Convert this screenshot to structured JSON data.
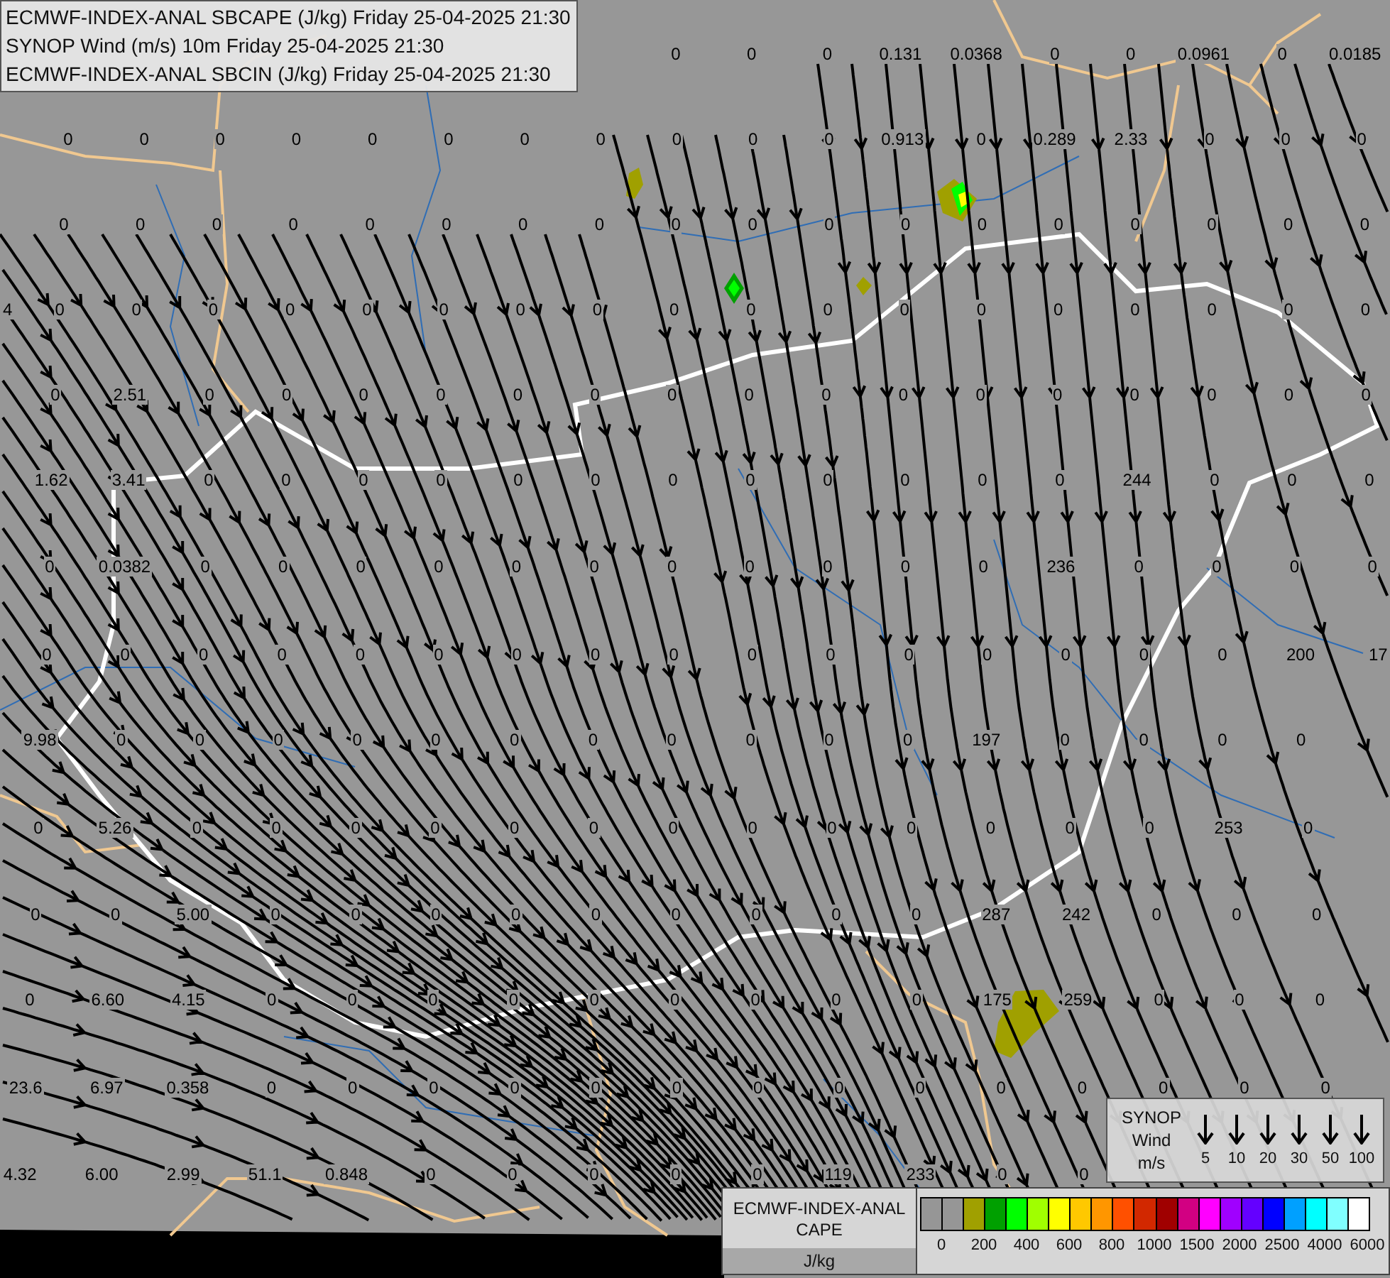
{
  "header": {
    "lines": [
      "ECMWF-INDEX-ANAL SBCAPE (J/kg) Friday 25-04-2025 21:30",
      "SYNOP Wind (m/s) 10m Friday 25-04-2025 21:30",
      "ECMWF-INDEX-ANAL SBCIN (J/kg) Friday 25-04-2025 21:30"
    ]
  },
  "map": {
    "value_rows": [
      [
        "0",
        "0",
        "0",
        "0.131",
        "0.0368",
        "0",
        "0",
        "0.0961",
        "0",
        "0.0185"
      ],
      [
        "0",
        "0",
        "0",
        "0",
        "0",
        "0",
        "0",
        "0",
        "0",
        "0",
        "0",
        "0.913",
        "0",
        "0.289",
        "2.33",
        "0",
        "0",
        "0"
      ],
      [
        "0",
        "0",
        "0",
        "0",
        "0",
        "0",
        "0",
        "0",
        "0",
        "0",
        "0",
        "0",
        "0",
        "0",
        "0",
        "0",
        "0",
        "0"
      ],
      [
        "4",
        "0",
        "0",
        "0",
        "0",
        "0",
        "0",
        "0",
        "0",
        "0",
        "0",
        "0",
        "0",
        "0",
        "0",
        "0",
        "0",
        "0",
        "0"
      ],
      [
        "0",
        "2.51",
        "0",
        "0",
        "0",
        "0",
        "0",
        "0",
        "0",
        "0",
        "0",
        "0",
        "0",
        "0",
        "0",
        "0",
        "0",
        "0"
      ],
      [
        "1.62",
        "3.41",
        "0",
        "0",
        "0",
        "0",
        "0",
        "0",
        "0",
        "0",
        "0",
        "0",
        "0",
        "0",
        "244",
        "0",
        "0",
        "0"
      ],
      [
        "0",
        "0.0382",
        "0",
        "0",
        "0",
        "0",
        "0",
        "0",
        "0",
        "0",
        "0",
        "0",
        "0",
        "236",
        "0",
        "0",
        "0",
        "0"
      ],
      [
        "0",
        "0",
        "0",
        "0",
        "0",
        "0",
        "0",
        "0",
        "0",
        "0",
        "0",
        "0",
        "0",
        "0",
        "0",
        "0",
        "200",
        "17"
      ],
      [
        "9.98",
        "0",
        "0",
        "0",
        "0",
        "0",
        "0",
        "0",
        "0",
        "0",
        "0",
        "0",
        "197",
        "0",
        "0",
        "0",
        "0"
      ],
      [
        "0",
        "5.26",
        "0",
        "0",
        "0",
        "0",
        "0",
        "0",
        "0",
        "0",
        "0",
        "0",
        "0",
        "0",
        "0",
        "253",
        "0"
      ],
      [
        "0",
        "0",
        "5.00",
        "0",
        "0",
        "0",
        "0",
        "0",
        "0",
        "0",
        "0",
        "0",
        "287",
        "242",
        "0",
        "0",
        "0"
      ],
      [
        "0",
        "6.60",
        "4.15",
        "0",
        "0",
        "0",
        "0",
        "0",
        "0",
        "0",
        "0",
        "0",
        "175",
        "259",
        "0",
        "0",
        "0"
      ],
      [
        "23.6",
        "6.97",
        "0.358",
        "0",
        "0",
        "0",
        "0",
        "0",
        "0",
        "0",
        "0",
        "0",
        "0",
        "0",
        "0",
        "0",
        "0"
      ],
      [
        "4.32",
        "6.00",
        "2.99",
        "51.1",
        "0.848",
        "0",
        "0",
        "0",
        "0",
        "0",
        "119",
        "233",
        "0",
        "0"
      ]
    ]
  },
  "wind_legend": {
    "title_lines": [
      "SYNOP",
      "Wind",
      "m/s"
    ],
    "speeds": [
      "5",
      "10",
      "20",
      "30",
      "50",
      "100"
    ]
  },
  "cape_legend": {
    "title_lines": [
      "ECMWF-INDEX-ANAL",
      "CAPE"
    ],
    "unit": "J/kg",
    "swatches": [
      {
        "color": "#969696"
      },
      {
        "color": "#969696"
      },
      {
        "color": "#a0a000"
      },
      {
        "color": "#00a000"
      },
      {
        "color": "#00ff00"
      },
      {
        "color": "#a0ff00"
      },
      {
        "color": "#ffff00"
      },
      {
        "color": "#ffc800"
      },
      {
        "color": "#ff9600"
      },
      {
        "color": "#ff5000"
      },
      {
        "color": "#d22800"
      },
      {
        "color": "#a00000"
      },
      {
        "color": "#d20082"
      },
      {
        "color": "#ff00ff"
      },
      {
        "color": "#a000ff"
      },
      {
        "color": "#6400ff"
      },
      {
        "color": "#0000ff"
      },
      {
        "color": "#00a0ff"
      },
      {
        "color": "#00ffff"
      },
      {
        "color": "#80ffff"
      },
      {
        "color": "#ffffff"
      }
    ],
    "ticks": [
      "0",
      "200",
      "400",
      "600",
      "800",
      "1000",
      "1500",
      "2000",
      "2500",
      "4000",
      "6000"
    ]
  }
}
